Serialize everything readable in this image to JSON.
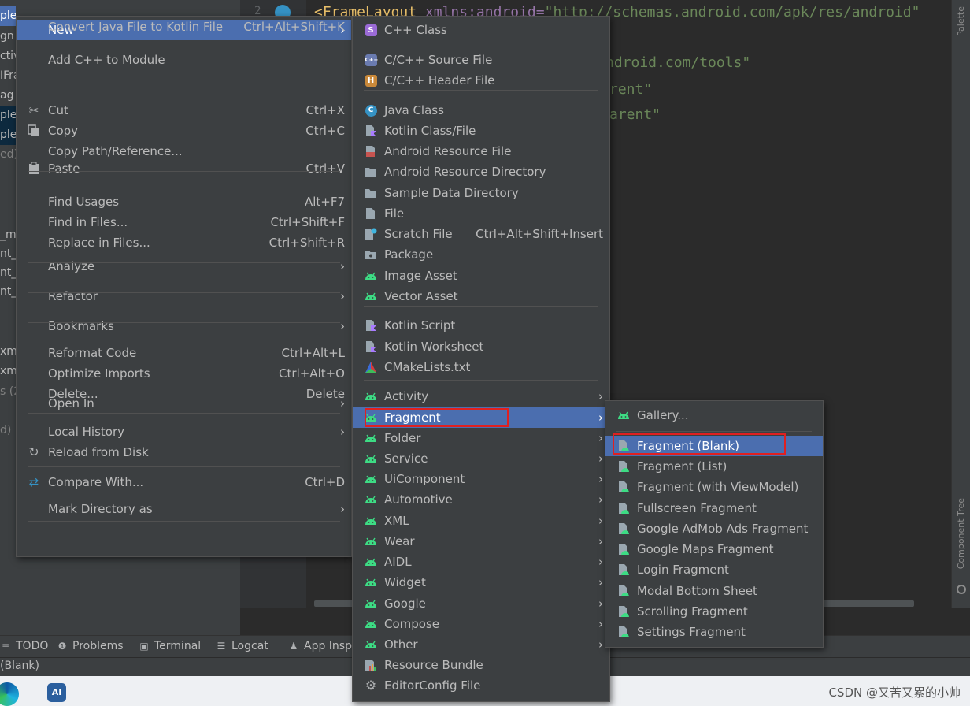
{
  "project_panel": {
    "rows": [
      {
        "text": "ple",
        "state": "highlight"
      },
      {
        "text": "gn",
        "state": "normal"
      },
      {
        "text": "ctiv",
        "state": "normal"
      },
      {
        "text": "IFra",
        "state": "normal"
      },
      {
        "text": "ag",
        "state": "normal"
      },
      {
        "text": "ple",
        "state": "selected"
      },
      {
        "text": "ple",
        "state": "selected"
      },
      {
        "text": "ed)",
        "state": "muted"
      },
      {
        "text": "_m",
        "state": "normal"
      },
      {
        "text": "nt_",
        "state": "normal"
      },
      {
        "text": "nt_",
        "state": "normal"
      },
      {
        "text": "nt_",
        "state": "normal"
      },
      {
        "text": "xm",
        "state": "normal"
      },
      {
        "text": "xm",
        "state": "normal"
      },
      {
        "text": "s (2",
        "state": "muted"
      },
      {
        "text": "d)",
        "state": "muted"
      }
    ]
  },
  "editor": {
    "line_number": "2",
    "lines": [
      {
        "tag": "<FrameLayout ",
        "attr": "xmlns:android=",
        "value": "\"http://schemas.android.com/apk/res/android\""
      },
      {
        "tag": "",
        "attr": "",
        "value": "ndroid.com/tools\""
      },
      {
        "tag": "",
        "attr": "",
        "value": "rent\""
      },
      {
        "tag": "",
        "attr": "",
        "value": "arent\""
      }
    ]
  },
  "right_strip": {
    "top_label": "Palette",
    "bottom_label": "Component Tree"
  },
  "tool_windows": [
    {
      "label": "TODO",
      "icon": "list-icon"
    },
    {
      "label": "Problems",
      "icon": "problems-icon"
    },
    {
      "label": "Terminal",
      "icon": "terminal-icon"
    },
    {
      "label": "Logcat",
      "icon": "logcat-icon"
    },
    {
      "label": "App Inspe",
      "icon": "inspection-icon"
    }
  ],
  "status_bar": {
    "text": "(Blank)"
  },
  "taskbar": {
    "studio_label": "AI"
  },
  "watermark": "CSDN @又苦又累的小帅",
  "context_menu": [
    {
      "type": "item",
      "label": "New",
      "submenu": true,
      "selected": true
    },
    {
      "type": "sep"
    },
    {
      "type": "item",
      "label": "Add C++ to Module"
    },
    {
      "type": "sep"
    },
    {
      "type": "item",
      "label": "Cut",
      "shortcut": "Ctrl+X",
      "icon": "scissors-icon"
    },
    {
      "type": "item",
      "label": "Copy",
      "shortcut": "Ctrl+C",
      "icon": "copy-icon"
    },
    {
      "type": "item",
      "label": "Copy Path/Reference..."
    },
    {
      "type": "item",
      "label": "Paste",
      "shortcut": "Ctrl+V",
      "icon": "clipboard-icon"
    },
    {
      "type": "sep"
    },
    {
      "type": "item",
      "label": "Find Usages",
      "shortcut": "Alt+F7"
    },
    {
      "type": "item",
      "label": "Find in Files...",
      "shortcut": "Ctrl+Shift+F"
    },
    {
      "type": "item",
      "label": "Replace in Files...",
      "shortcut": "Ctrl+Shift+R"
    },
    {
      "type": "item",
      "label": "Analyze",
      "submenu": true
    },
    {
      "type": "sep"
    },
    {
      "type": "item",
      "label": "Refactor",
      "submenu": true
    },
    {
      "type": "sep"
    },
    {
      "type": "item",
      "label": "Bookmarks",
      "submenu": true
    },
    {
      "type": "sep"
    },
    {
      "type": "item",
      "label": "Reformat Code",
      "shortcut": "Ctrl+Alt+L"
    },
    {
      "type": "item",
      "label": "Optimize Imports",
      "shortcut": "Ctrl+Alt+O"
    },
    {
      "type": "item",
      "label": "Delete...",
      "shortcut": "Delete"
    },
    {
      "type": "sep"
    },
    {
      "type": "item",
      "label": "Open In",
      "submenu": true
    },
    {
      "type": "sep"
    },
    {
      "type": "item",
      "label": "Local History",
      "submenu": true
    },
    {
      "type": "item",
      "label": "Reload from Disk",
      "icon": "reload-icon"
    },
    {
      "type": "sep"
    },
    {
      "type": "item",
      "label": "Compare With...",
      "shortcut": "Ctrl+D",
      "icon": "compare-icon"
    },
    {
      "type": "sep"
    },
    {
      "type": "item",
      "label": "Mark Directory as",
      "submenu": true
    },
    {
      "type": "sep"
    },
    {
      "type": "item",
      "label": "Convert Java File to Kotlin File",
      "shortcut": "Ctrl+Alt+Shift+K"
    }
  ],
  "new_submenu": [
    {
      "type": "item",
      "label": "C++ Class",
      "icon": "cpp-class-icon"
    },
    {
      "type": "sep"
    },
    {
      "type": "item",
      "label": "C/C++ Source File",
      "icon": "cpp-source-icon"
    },
    {
      "type": "item",
      "label": "C/C++ Header File",
      "icon": "cpp-header-icon"
    },
    {
      "type": "sep"
    },
    {
      "type": "item",
      "label": "Java Class",
      "icon": "java-class-icon"
    },
    {
      "type": "item",
      "label": "Kotlin Class/File",
      "icon": "kotlin-file-icon"
    },
    {
      "type": "item",
      "label": "Android Resource File",
      "icon": "resource-file-icon"
    },
    {
      "type": "item",
      "label": "Android Resource Directory",
      "icon": "folder-icon"
    },
    {
      "type": "item",
      "label": "Sample Data Directory",
      "icon": "folder-icon"
    },
    {
      "type": "item",
      "label": "File",
      "icon": "file-icon"
    },
    {
      "type": "item",
      "label": "Scratch File",
      "shortcut": "Ctrl+Alt+Shift+Insert",
      "icon": "scratch-file-icon"
    },
    {
      "type": "item",
      "label": "Package",
      "icon": "package-icon"
    },
    {
      "type": "item",
      "label": "Image Asset",
      "icon": "android-icon"
    },
    {
      "type": "item",
      "label": "Vector Asset",
      "icon": "android-icon"
    },
    {
      "type": "sep"
    },
    {
      "type": "item",
      "label": "Kotlin Script",
      "icon": "kotlin-script-icon"
    },
    {
      "type": "item",
      "label": "Kotlin Worksheet",
      "icon": "kotlin-worksheet-icon"
    },
    {
      "type": "item",
      "label": "CMakeLists.txt",
      "icon": "cmake-icon"
    },
    {
      "type": "sep"
    },
    {
      "type": "item",
      "label": "Activity",
      "submenu": true,
      "icon": "android-icon"
    },
    {
      "type": "item",
      "label": "Fragment",
      "submenu": true,
      "selected": true,
      "icon": "android-icon"
    },
    {
      "type": "item",
      "label": "Folder",
      "submenu": true,
      "icon": "android-icon"
    },
    {
      "type": "item",
      "label": "Service",
      "submenu": true,
      "icon": "android-icon"
    },
    {
      "type": "item",
      "label": "UiComponent",
      "submenu": true,
      "icon": "android-icon"
    },
    {
      "type": "item",
      "label": "Automotive",
      "submenu": true,
      "icon": "android-icon"
    },
    {
      "type": "item",
      "label": "XML",
      "submenu": true,
      "icon": "android-icon"
    },
    {
      "type": "item",
      "label": "Wear",
      "submenu": true,
      "icon": "android-icon"
    },
    {
      "type": "item",
      "label": "AIDL",
      "submenu": true,
      "icon": "android-icon"
    },
    {
      "type": "item",
      "label": "Widget",
      "submenu": true,
      "icon": "android-icon"
    },
    {
      "type": "item",
      "label": "Google",
      "submenu": true,
      "icon": "android-icon"
    },
    {
      "type": "item",
      "label": "Compose",
      "submenu": true,
      "icon": "android-icon"
    },
    {
      "type": "item",
      "label": "Other",
      "submenu": true,
      "icon": "android-icon"
    },
    {
      "type": "item",
      "label": "Resource Bundle",
      "icon": "resource-bundle-icon"
    },
    {
      "type": "item",
      "label": "EditorConfig File",
      "icon": "gear-icon"
    }
  ],
  "fragment_submenu": [
    {
      "type": "item",
      "label": "Gallery...",
      "icon": "android-icon"
    },
    {
      "type": "sep"
    },
    {
      "type": "item",
      "label": "Fragment (Blank)",
      "selected": true,
      "icon": "android-file-icon"
    },
    {
      "type": "item",
      "label": "Fragment (List)",
      "icon": "android-file-icon"
    },
    {
      "type": "item",
      "label": "Fragment (with ViewModel)",
      "icon": "android-file-icon"
    },
    {
      "type": "item",
      "label": "Fullscreen Fragment",
      "icon": "android-file-icon"
    },
    {
      "type": "item",
      "label": "Google AdMob Ads Fragment",
      "icon": "android-file-icon"
    },
    {
      "type": "item",
      "label": "Google Maps Fragment",
      "icon": "android-file-icon"
    },
    {
      "type": "item",
      "label": "Login Fragment",
      "icon": "android-file-icon"
    },
    {
      "type": "item",
      "label": "Modal Bottom Sheet",
      "icon": "android-file-icon"
    },
    {
      "type": "item",
      "label": "Scrolling Fragment",
      "icon": "android-file-icon"
    },
    {
      "type": "item",
      "label": "Settings Fragment",
      "icon": "android-file-icon"
    }
  ],
  "colors": {
    "menu_bg": "#3c3f41",
    "selection": "#4b6eaf",
    "separator": "#515151",
    "android_green": "#3ddc84",
    "highlight_box": "#e02020"
  }
}
